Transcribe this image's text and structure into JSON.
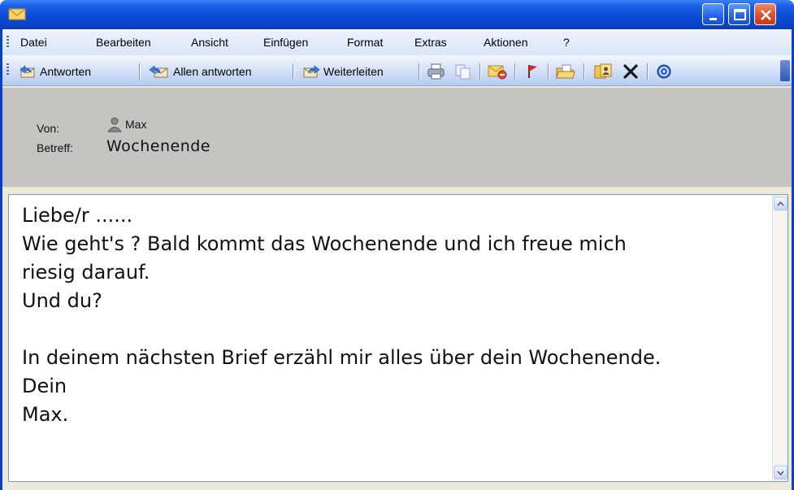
{
  "window": {
    "controls": [
      "minimize",
      "maximize",
      "close"
    ]
  },
  "menu": {
    "items": [
      "Datei",
      "Bearbeiten",
      "Ansicht",
      "Einfügen",
      "Format",
      "Extras",
      "Aktionen",
      "?"
    ]
  },
  "toolbar": {
    "reply_label": "Antworten",
    "reply_all_label": "Allen antworten",
    "forward_label": "Weiterleiten",
    "icons": [
      "print-icon",
      "copy-icon",
      "mark-unread-icon",
      "flag-icon",
      "move-to-folder-icon",
      "contacts-icon",
      "delete-icon",
      "help-icon"
    ]
  },
  "header": {
    "from_label": "Von:",
    "from_value": "Max",
    "subject_label": "Betreff:",
    "subject_value": "Wochenende"
  },
  "body": {
    "lines": [
      "Liebe/r ......",
      "Wie geht's ? Bald kommt das Wochenende und ich freue mich",
      "riesig darauf.",
      "Und du?",
      "",
      "In deinem nächsten Brief erzähl mir alles über dein Wochenende.",
      "Dein",
      "Max."
    ]
  },
  "colors": {
    "titlebar": "#0b4bd6",
    "header_bg": "#c6c4c0",
    "close_button": "#d9502b"
  }
}
